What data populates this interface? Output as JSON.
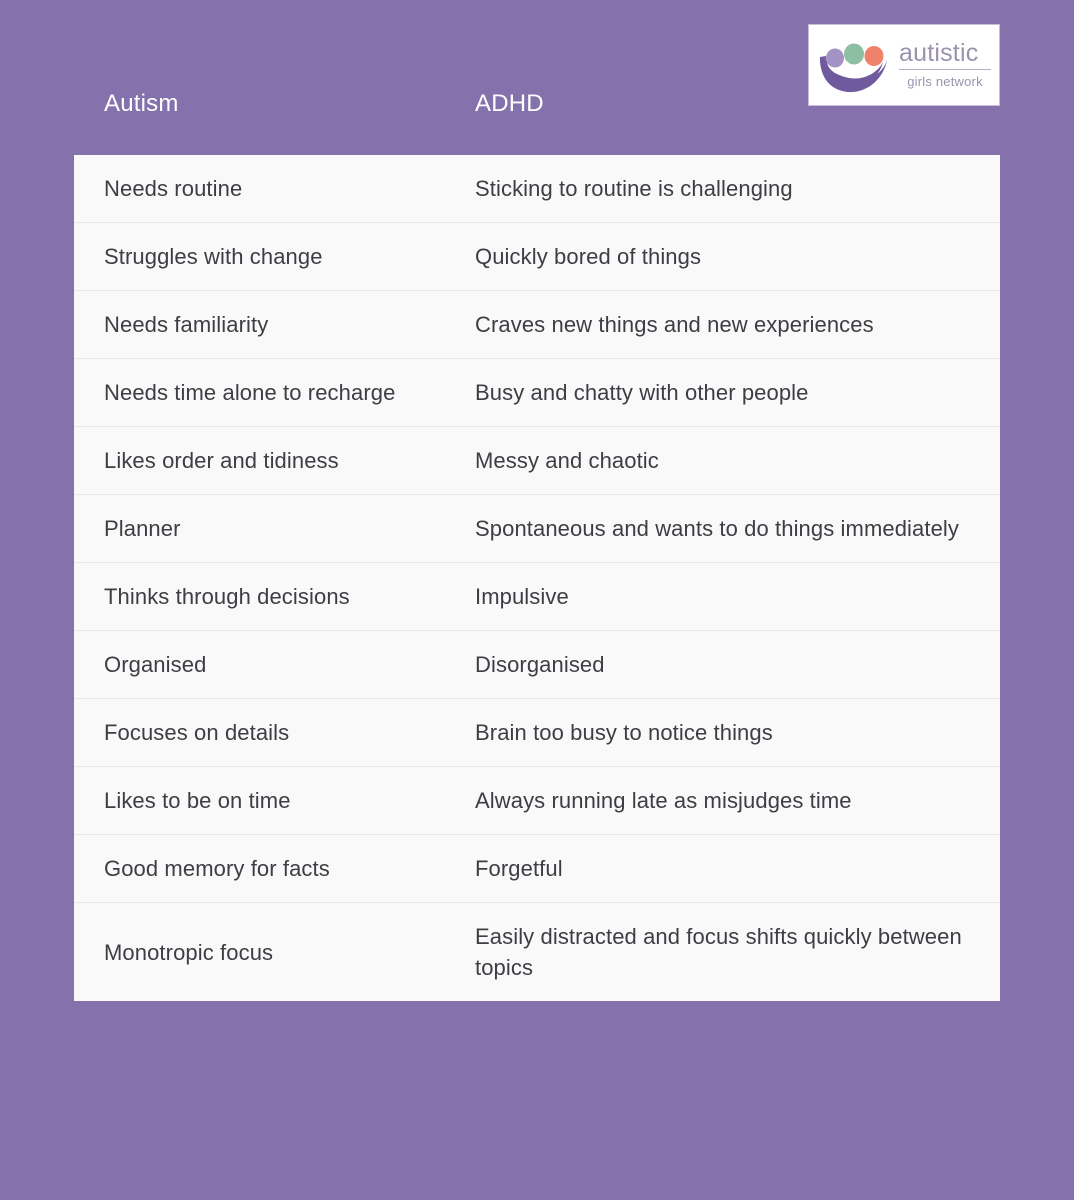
{
  "background_color": "#8571ab",
  "logo": {
    "name": "autistic-girls-network-logo",
    "word_main": "autistic",
    "word_sub": "girls network",
    "circle_colors": [
      "#a393c4",
      "#8dbfa2",
      "#f0816a"
    ],
    "bowl_color": "#6f5a9e",
    "text_color": "#9b93ae"
  },
  "table": {
    "columns": [
      "Autism",
      "ADHD"
    ],
    "header_text_color": "#ffffff",
    "row_background": "#f9f9f9",
    "divider_color": "#e9e9e9",
    "cell_text_color": "#3c3e44",
    "rows": [
      {
        "autism": "Needs routine",
        "adhd": "Sticking to routine is challenging"
      },
      {
        "autism": "Struggles with change",
        "adhd": "Quickly bored of things"
      },
      {
        "autism": "Needs familiarity",
        "adhd": "Craves new things and new experiences"
      },
      {
        "autism": "Needs time alone to recharge",
        "adhd": "Busy and chatty with other people"
      },
      {
        "autism": "Likes order and tidiness",
        "adhd": "Messy and chaotic"
      },
      {
        "autism": "Planner",
        "adhd": "Spontaneous and wants to do things immediately"
      },
      {
        "autism": "Thinks through decisions",
        "adhd": "Impulsive"
      },
      {
        "autism": "Organised",
        "adhd": "Disorganised"
      },
      {
        "autism": "Focuses on details",
        "adhd": "Brain too busy to notice things"
      },
      {
        "autism": "Likes to be on time",
        "adhd": "Always running late as misjudges time"
      },
      {
        "autism": "Good memory for facts",
        "adhd": "Forgetful"
      },
      {
        "autism": "Monotropic focus",
        "adhd": "Easily distracted and focus shifts quickly between topics"
      }
    ]
  }
}
